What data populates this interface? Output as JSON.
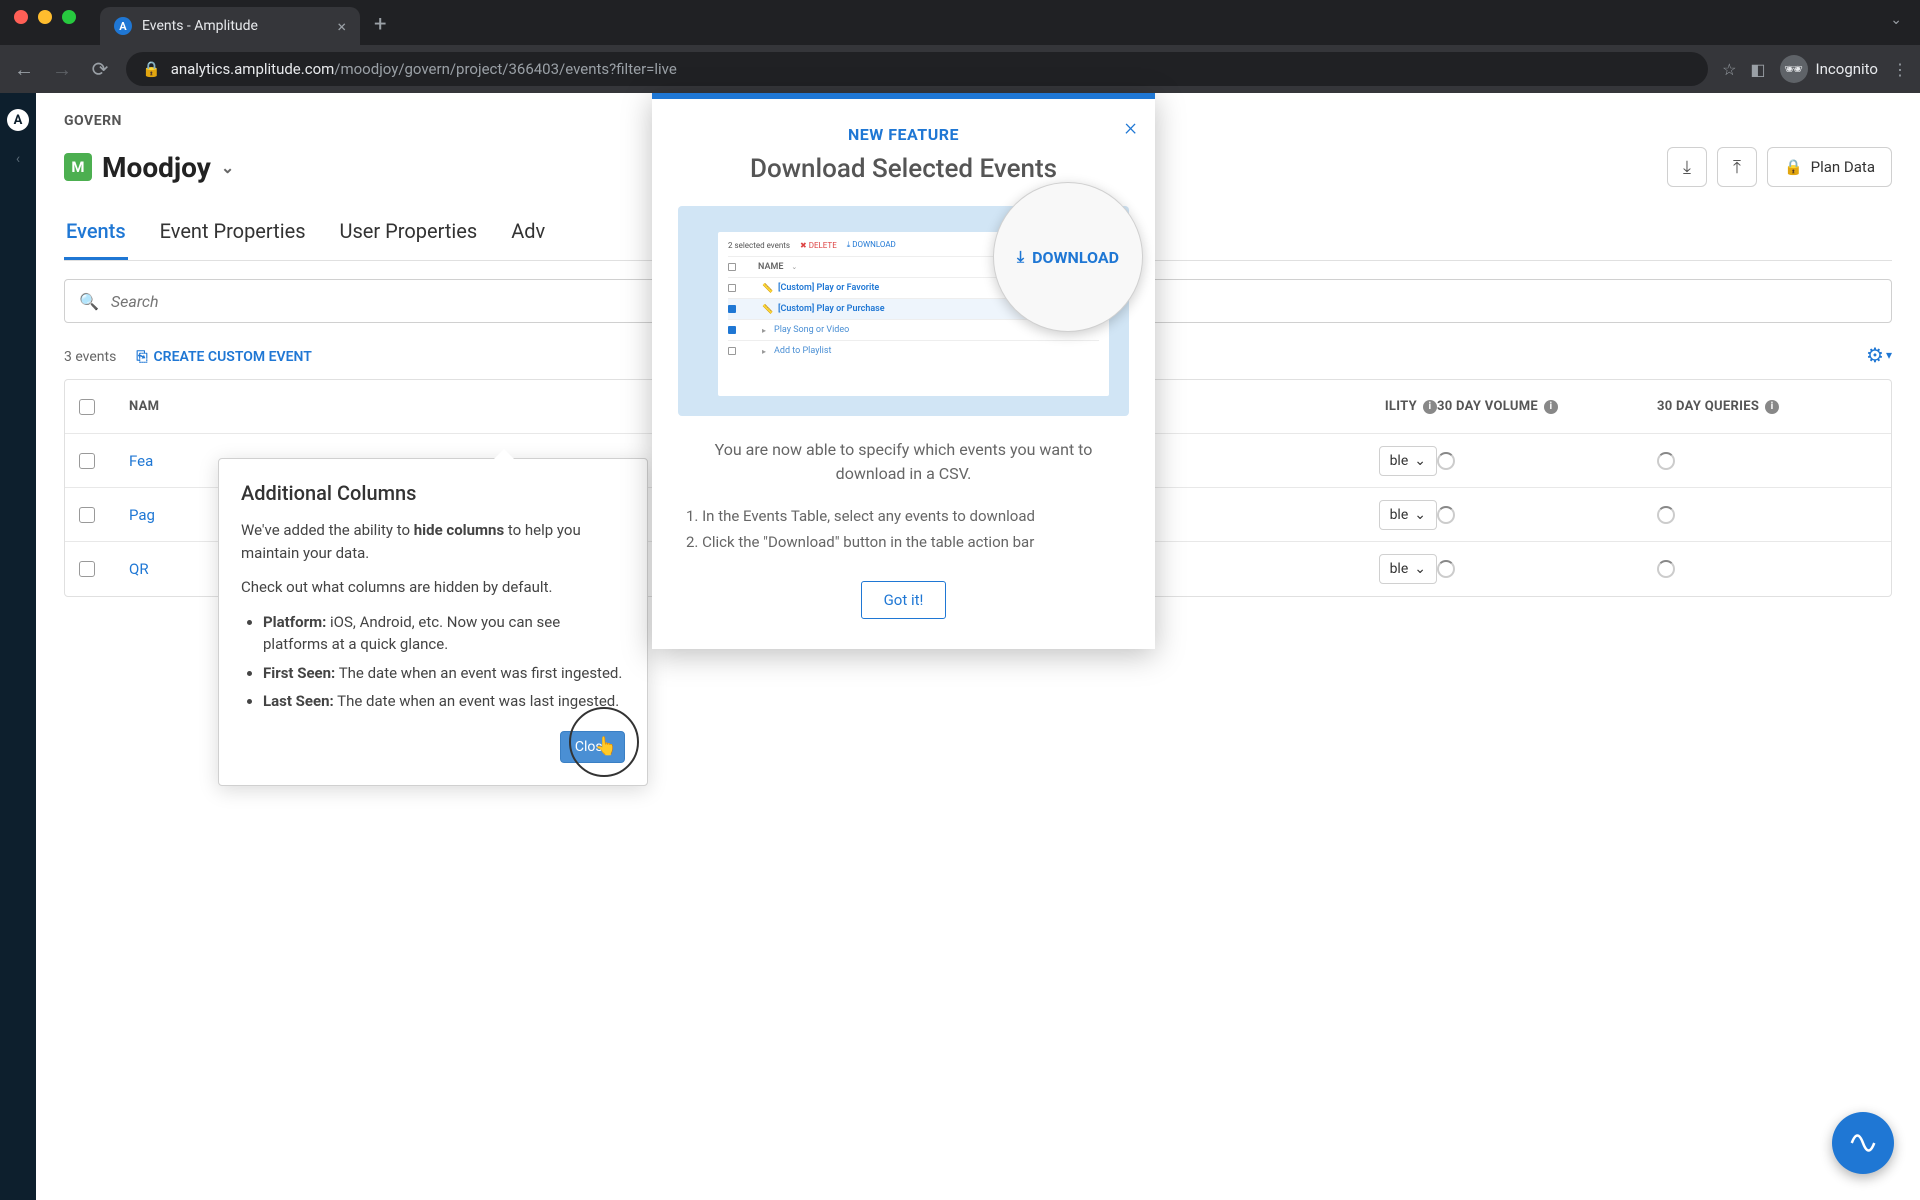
{
  "browser": {
    "tab_title": "Events - Amplitude",
    "url_display": "analytics.amplitude.com/moodjoy/govern/project/366403/events?filter=live",
    "url_domain": "analytics.amplitude.com",
    "url_path": "/moodjoy/govern/project/366403/events?filter=live",
    "incognito_label": "Incognito"
  },
  "header": {
    "breadcrumb": "GOVERN",
    "project_badge": "M",
    "project_name": "Moodjoy",
    "download_tooltip": "Download",
    "upload_tooltip": "Upload",
    "plan_data_label": "Plan Data"
  },
  "tabs": {
    "events": "Events",
    "event_properties": "Event Properties",
    "user_properties": "User Properties",
    "advanced": "Adv"
  },
  "search": {
    "placeholder": "Search"
  },
  "toolbar": {
    "count_label": "3 events",
    "create_label": "CREATE CUSTOM EVENT"
  },
  "table": {
    "columns": {
      "name": "NAM",
      "visibility": "ILITY",
      "volume": "30 DAY VOLUME",
      "queries": "30 DAY QUERIES"
    },
    "rows": [
      {
        "name_fragment": "Fea",
        "visibility": "ble"
      },
      {
        "name_fragment": "Pag",
        "visibility": "ble"
      },
      {
        "name_fragment": "QR",
        "visibility": "ble"
      }
    ]
  },
  "popover": {
    "title": "Additional Columns",
    "intro_prefix": "We've added the ability to ",
    "intro_bold": "hide columns",
    "intro_suffix": " to help you maintain your data.",
    "check_line": "Check out what columns are hidden by default.",
    "bullets": [
      {
        "label": "Platform:",
        "text": " iOS, Android, etc. Now you can see platforms at a quick glance."
      },
      {
        "label": "First Seen:",
        "text": " The date when an event was first ingested."
      },
      {
        "label": "Last Seen:",
        "text": " The date when an event was last ingested."
      }
    ],
    "close_label": "Close"
  },
  "modal": {
    "eyebrow": "NEW FEATURE",
    "title": "Download Selected Events",
    "download_label": "DOWNLOAD",
    "illus": {
      "selected_text": "2 selected events",
      "delete_text": "DELETE",
      "download_text": "DOWNLOAD",
      "name_col": "NAME",
      "rows": [
        "[Custom] Play or Favorite",
        "[Custom] Play or Purchase",
        "Play Song or Video",
        "Add to Playlist"
      ]
    },
    "description": "You are now able to specify which events you want to download in a CSV.",
    "step1": "1. In the Events Table, select any events to download",
    "step2": "2. Click the \"Download\" button in the table action bar",
    "gotit_label": "Got it!"
  }
}
